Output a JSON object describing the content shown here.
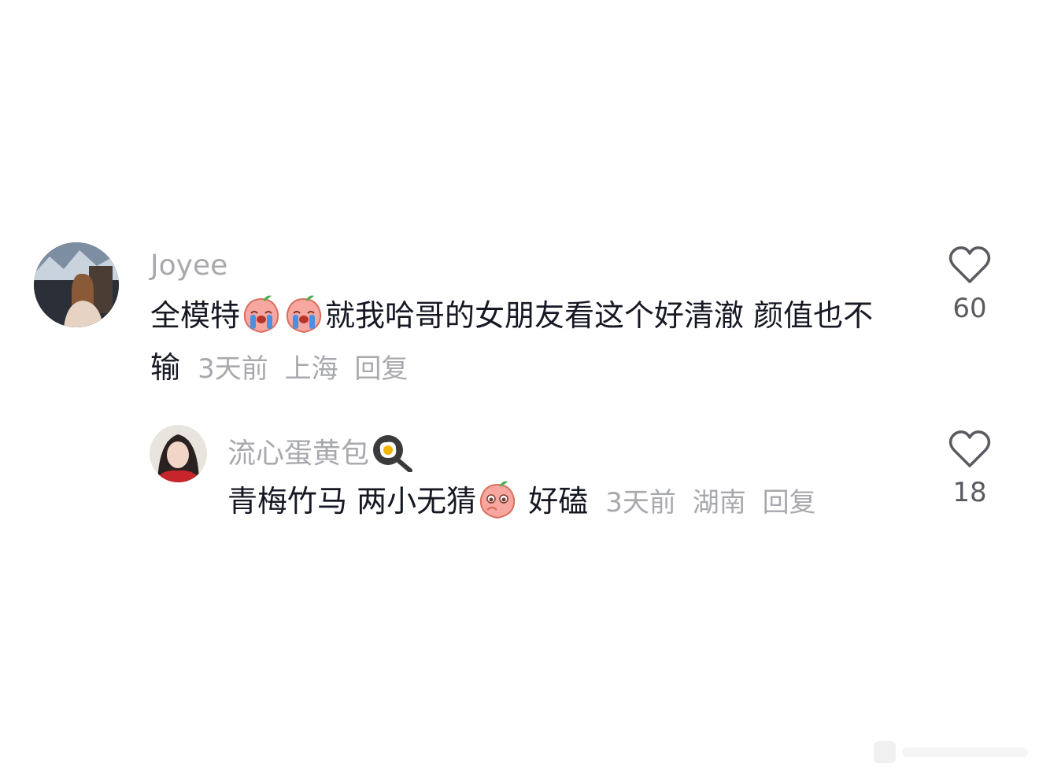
{
  "comments": [
    {
      "username": "Joyee",
      "text_a": "全模特",
      "text_b": "就我哈哥的女朋友看这个好清澈 颜值也不输",
      "time": "3天前",
      "location": "上海",
      "reply_label": "回复",
      "likes": "60",
      "emojis": [
        "crying-peach-emoji",
        "crying-peach-emoji"
      ]
    },
    {
      "username": "流心蛋黄包",
      "username_icon": "fried-egg-pan-icon",
      "text_a": "青梅竹马 两小无猜",
      "text_b": "好磕",
      "time": "3天前",
      "location": "湖南",
      "reply_label": "回复",
      "likes": "18",
      "emojis": [
        "shy-peach-emoji"
      ]
    }
  ],
  "colors": {
    "text": "#161823",
    "meta": "#a8a9ad",
    "like_count": "#5a5b60",
    "heart_stroke": "#5a5b60",
    "peach": "#f7a7a0"
  }
}
